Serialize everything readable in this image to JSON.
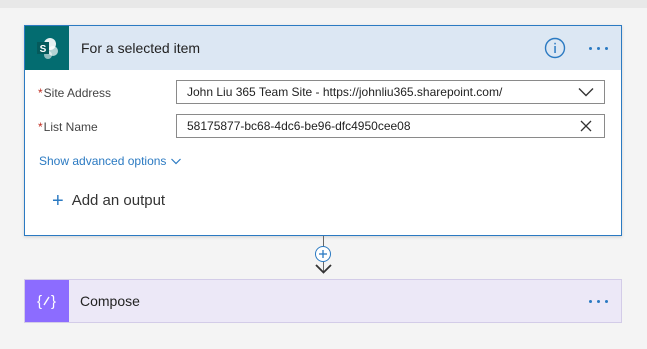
{
  "colors": {
    "accent": "#2b7ac2",
    "sharepoint": "#036c70",
    "trigger_header": "#dce7f3",
    "compose_icon": "#8c6cff",
    "compose_bg": "#ece8f7",
    "required": "#c02b1e"
  },
  "trigger": {
    "icon": "sharepoint-icon",
    "title": "For a selected item",
    "info_icon": "info-icon",
    "more_icon": "more-options-icon",
    "fields": [
      {
        "required_mark": "*",
        "label": "Site Address",
        "value": "John Liu 365 Team Site - https://johnliu365.sharepoint.com/",
        "action_icon": "chevron-down-icon"
      },
      {
        "required_mark": "*",
        "label": "List Name",
        "value": "58175877-bc68-4dc6-be96-dfc4950cee08",
        "action_icon": "clear-icon"
      }
    ],
    "advanced_options_label": "Show advanced options",
    "add_output_label": "Add an output"
  },
  "connector": {
    "insert_icon": "plus-circle-icon",
    "arrow_icon": "arrow-down-icon"
  },
  "compose": {
    "icon": "compose-icon",
    "title": "Compose",
    "more_icon": "more-options-icon"
  }
}
